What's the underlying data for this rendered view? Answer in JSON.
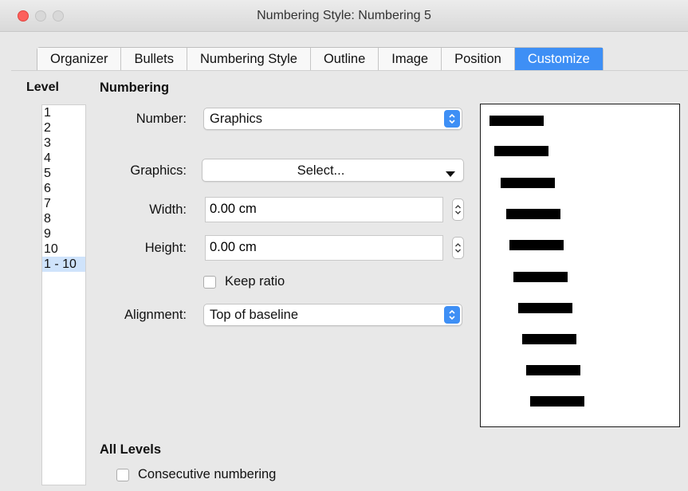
{
  "window": {
    "title": "Numbering Style: Numbering 5"
  },
  "tabs": [
    {
      "label": "Organizer",
      "active": false
    },
    {
      "label": "Bullets",
      "active": false
    },
    {
      "label": "Numbering Style",
      "active": false
    },
    {
      "label": "Outline",
      "active": false
    },
    {
      "label": "Image",
      "active": false
    },
    {
      "label": "Position",
      "active": false
    },
    {
      "label": "Customize",
      "active": true
    }
  ],
  "level": {
    "heading": "Level",
    "items": [
      "1",
      "2",
      "3",
      "4",
      "5",
      "6",
      "7",
      "8",
      "9",
      "10",
      "1 - 10"
    ],
    "selected": "1 - 10"
  },
  "numbering": {
    "heading": "Numbering",
    "number_label": "Number:",
    "number_value": "Graphics",
    "graphics_label": "Graphics:",
    "graphics_button": "Select...",
    "width_label": "Width:",
    "width_value": "0.00 cm",
    "height_label": "Height:",
    "height_value": "0.00 cm",
    "keep_ratio_label": "Keep ratio",
    "keep_ratio_checked": false,
    "alignment_label": "Alignment:",
    "alignment_value": "Top of baseline"
  },
  "all_levels": {
    "heading": "All Levels",
    "consecutive_label": "Consecutive numbering",
    "consecutive_checked": false
  },
  "colors": {
    "accent": "#3e8ff5",
    "selection": "#cfe3fb",
    "close_button": "#fc605c"
  }
}
